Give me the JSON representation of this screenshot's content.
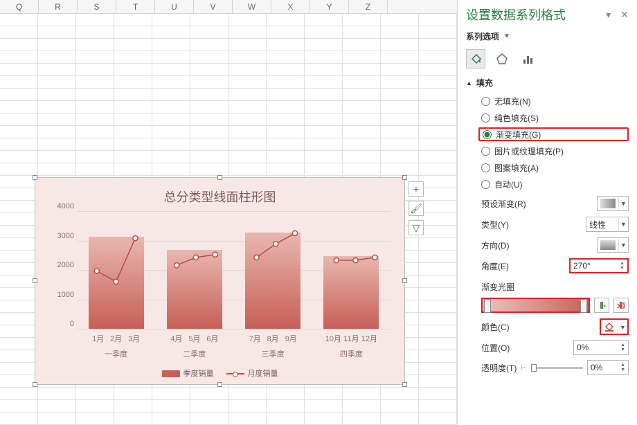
{
  "columns": [
    "Q",
    "R",
    "S",
    "T",
    "U",
    "V",
    "W",
    "X",
    "Y",
    "Z"
  ],
  "chart": {
    "title": "总分类型线面柱形图",
    "y_ticks": [
      "4000",
      "3000",
      "2000",
      "1000",
      "0"
    ],
    "x_months": [
      [
        "1月",
        "2月",
        "3月"
      ],
      [
        "4月",
        "5月",
        "6月"
      ],
      [
        "7月",
        "8月",
        "9月"
      ],
      [
        "10月",
        "11月",
        "12月"
      ]
    ],
    "x_quarters": [
      "一季度",
      "二季度",
      "三季度",
      "四季度"
    ],
    "legend_bar": "季度销量",
    "legend_line": "月度销量",
    "tools": {
      "plus": "+",
      "brush": "🖌",
      "filter": "▽"
    }
  },
  "chart_data": {
    "type": "bar+line",
    "categories": [
      "一季度",
      "二季度",
      "三季度",
      "四季度"
    ],
    "series": [
      {
        "name": "季度销量",
        "type": "area-bar",
        "values": [
          3500,
          3000,
          3700,
          2800
        ]
      }
    ],
    "line_series": {
      "name": "月度销量",
      "months": [
        "1月",
        "2月",
        "3月",
        "4月",
        "5月",
        "6月",
        "7月",
        "8月",
        "9月",
        "10月",
        "11月",
        "12月"
      ],
      "values": [
        2300,
        1900,
        3500,
        2500,
        2800,
        2900,
        2800,
        3300,
        3700,
        2700,
        2700,
        2800
      ]
    },
    "ylim": [
      0,
      4500
    ],
    "title": "总分类型线面柱形图",
    "xlabel": "",
    "ylabel": ""
  },
  "panel": {
    "title": "设置数据系列格式",
    "series_option": "系列选项",
    "section_fill": "填充",
    "fills": {
      "no_fill": "无填充(N)",
      "solid": "纯色填充(S)",
      "gradient": "渐变填充(G)",
      "picture": "图片或纹理填充(P)",
      "pattern": "图案填充(A)",
      "auto": "自动(U)"
    },
    "props": {
      "preset": "预设渐变(R)",
      "type": "类型(Y)",
      "type_val": "线性",
      "direction": "方向(D)",
      "angle": "角度(E)",
      "angle_val": "270°",
      "gradstops": "渐变光圈",
      "color": "颜色(C)",
      "position": "位置(O)",
      "position_val": "0%",
      "transparency": "透明度(T)",
      "transparency_val": "0%"
    }
  }
}
